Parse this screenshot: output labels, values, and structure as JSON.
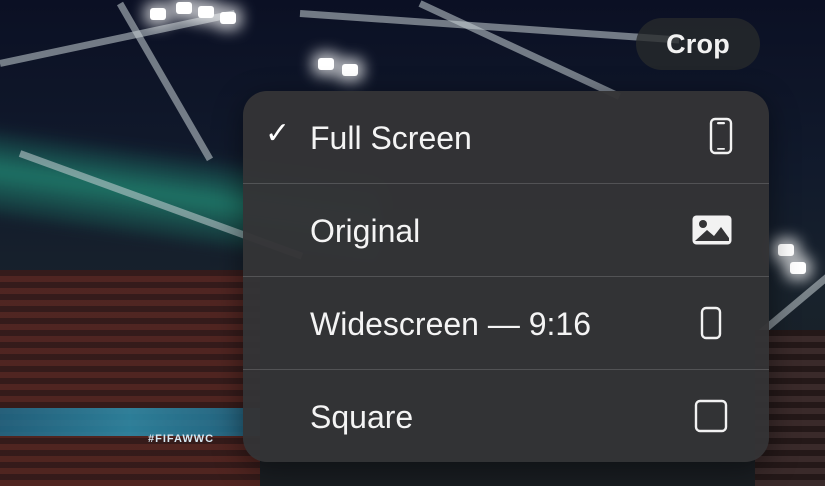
{
  "header": {
    "crop_label": "Crop"
  },
  "background": {
    "banner_text": "#FIFAWWC"
  },
  "menu": {
    "items": [
      {
        "label": "Full Screen",
        "checked": true,
        "check_glyph": "✓",
        "icon": "phone-icon"
      },
      {
        "label": "Original",
        "checked": false,
        "check_glyph": "",
        "icon": "photo-icon"
      },
      {
        "label": "Widescreen — 9:16",
        "checked": false,
        "check_glyph": "",
        "icon": "portrait-rectangle-icon"
      },
      {
        "label": "Square",
        "checked": false,
        "check_glyph": "",
        "icon": "square-icon"
      }
    ]
  },
  "colors": {
    "menu_bg": "#343436",
    "text": "#f4f4f4"
  }
}
